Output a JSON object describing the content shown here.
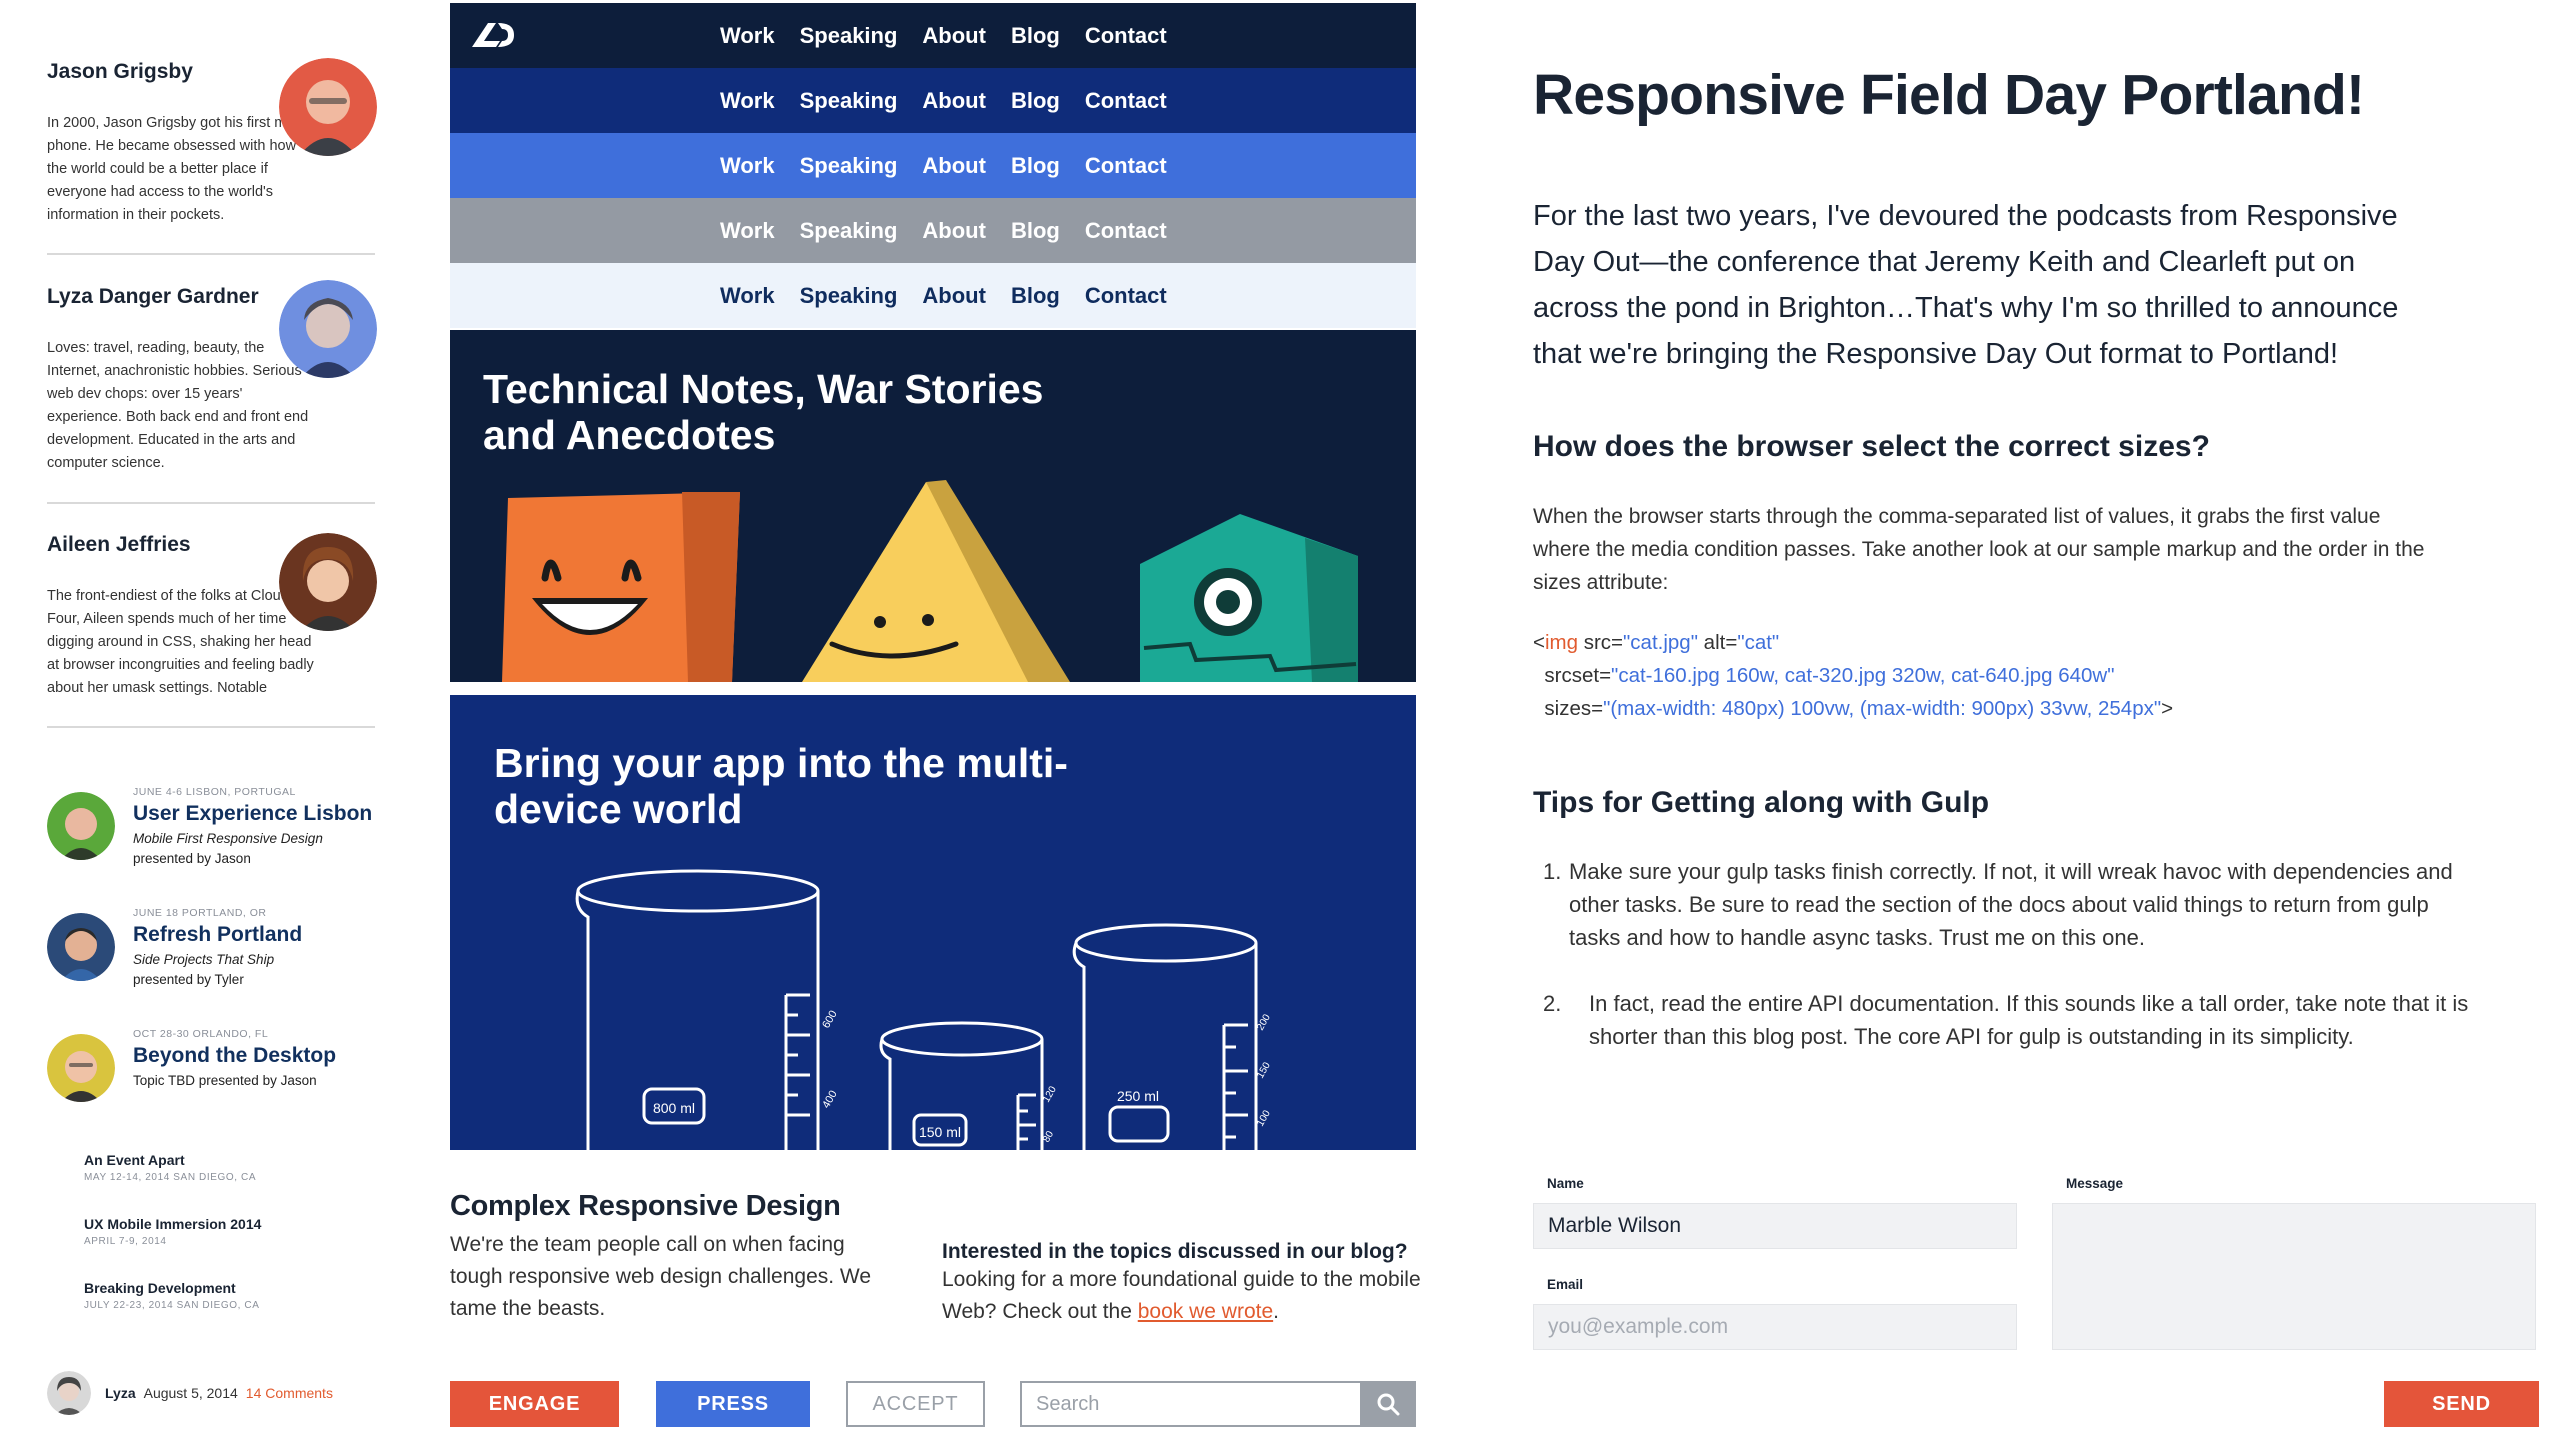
{
  "people": [
    {
      "name": "Jason Grigsby",
      "bio": "In 2000, Jason Grigsby got his first mobile phone. He became obsessed with how the world could be a better place if everyone had access to the world's information in their pockets."
    },
    {
      "name": "Lyza Danger Gardner",
      "bio": "Loves: travel, reading, beauty, the Internet, anachronistic hobbies. Serious web dev chops: over 15 years' experience. Both back end and front end development. Educated in the arts and computer science."
    },
    {
      "name": "Aileen Jeffries",
      "bio": "The front-endiest of the folks at Cloud Four, Aileen spends much of her time digging around in CSS, shaking her head at browser incongruities and feeling badly about her umask settings. Notable"
    }
  ],
  "events": [
    {
      "meta": "JUNE 4-6  LISBON, PORTUGAL",
      "title": "User Experience Lisbon",
      "subtitle": "Mobile First Responsive Design",
      "presenter": "presented by Jason"
    },
    {
      "meta": "JUNE 18  PORTLAND, OR",
      "title": "Refresh Portland",
      "subtitle": "Side Projects That Ship",
      "presenter": "presented by Tyler"
    },
    {
      "meta": "OCT 28-30  ORLANDO, FL",
      "title": "Beyond the Desktop",
      "subtitle": "",
      "presenter": "Topic TBD presented by Jason"
    }
  ],
  "mini_events": [
    {
      "title": "An Event Apart",
      "meta": "MAY 12-14, 2014  SAN DIEGO, CA"
    },
    {
      "title": "UX Mobile Immersion 2014",
      "meta": "APRIL 7-9, 2014"
    },
    {
      "title": "Breaking Development",
      "meta": "JULY 22-23, 2014  SAN DIEGO, CA"
    }
  ],
  "comment": {
    "user": "Lyza",
    "date": "August 5, 2014",
    "count": "14 Comments"
  },
  "nav": {
    "items": [
      "Work",
      "Speaking",
      "About",
      "Blog",
      "Contact"
    ]
  },
  "hero1": {
    "title": "Technical Notes, War Stories and Anecdotes"
  },
  "hero2": {
    "title": "Bring your app into the multi-device world",
    "beaker_labels": [
      "800 ml",
      "150 ml",
      "250 ml"
    ],
    "beaker_ticks": [
      "600",
      "400",
      "120",
      "80",
      "200",
      "150",
      "100"
    ]
  },
  "promo": {
    "title": "Complex Responsive Design",
    "body": "We're the team people call on when facing tough responsive web design challenges. We tame the beasts."
  },
  "interest": {
    "title": "Interested in the topics discussed in our blog?",
    "body_before": "Looking for a more foundational guide to the mobile Web? Check out the ",
    "link": "book we wrote",
    "body_after": "."
  },
  "buttons": {
    "engage": "ENGAGE",
    "press": "PRESS",
    "accept": "ACCEPT",
    "send": "SEND"
  },
  "search": {
    "placeholder": "Search"
  },
  "article": {
    "title": "Responsive Field Day Portland!",
    "intro": "For the last two years, I've devoured the podcasts from Responsive Day Out—the conference that Jeremy Keith and Clearleft put on across the pond in Brighton…That's why I'm so thrilled to announce that we're bringing the Responsive Day Out format to Portland!",
    "h2_sizes": "How does the browser select the correct sizes?",
    "para_sizes": "When the browser starts through the comma-separated list of values, it grabs the first value where the media condition passes. Take another look at our sample markup and the order in the sizes attribute:",
    "code": {
      "l1_open": "<",
      "l1_tag": "img",
      "l1_a1": " src=",
      "l1_v1": "\"cat.jpg\"",
      "l1_a2": " alt=",
      "l1_v2": "\"cat\"",
      "l2_a": "  srcset=",
      "l2_v": "\"cat-160.jpg 160w, cat-320.jpg 320w, cat-640.jpg 640w\"",
      "l3_a": "  sizes=",
      "l3_v": "\"(max-width: 480px) 100vw, (max-width: 900px) 33vw, 254px\"",
      "l3_close": ">"
    },
    "h2_gulp": "Tips for Getting along with Gulp",
    "list": [
      {
        "num": "1.",
        "text": "Make sure your gulp tasks finish correctly. If not, it will wreak havoc with dependencies and other tasks. Be sure to read the section of the docs about valid things to return from gulp tasks and how to handle async tasks. Trust me on this one."
      },
      {
        "num": "2.",
        "text": "In fact, read the entire API documentation. If this sounds like a tall order, take note that it is shorter than this blog post. The core API for gulp is outstanding in its simplicity."
      }
    ]
  },
  "form": {
    "name_label": "Name",
    "name_value": "Marble Wilson",
    "email_label": "Email",
    "email_placeholder": "you@example.com",
    "message_label": "Message"
  },
  "colors": {
    "navy": "#0d1e3b",
    "royal": "#0f2c7a",
    "blue": "#3f6fdb",
    "gray": "#949aa3",
    "orange": "#e4553a"
  },
  "icons": [
    "logo-icon",
    "search-icon"
  ]
}
